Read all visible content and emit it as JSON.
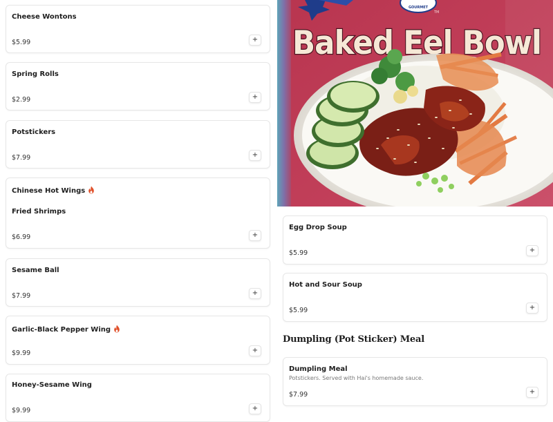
{
  "left_items": [
    {
      "name": "Cheese Wontons",
      "price": "$5.99"
    },
    {
      "name": "Spring Rolls",
      "price": "$2.99"
    },
    {
      "name": "Potstickers",
      "price": "$7.99"
    },
    {
      "name": "Chinese Hot Wings",
      "spicy": true
    },
    {
      "name": "Fried Shrimps",
      "price": "$6.99"
    },
    {
      "name": "Sesame Ball",
      "price": "$7.99"
    },
    {
      "name": "Garlic-Black Pepper Wing",
      "price": "$9.99",
      "spicy": true
    },
    {
      "name": "Honey-Sesame Wing",
      "price": "$9.99"
    }
  ],
  "hero_image": {
    "sign_text": "Baked Eel Bowl",
    "badge_text": "GOURMET",
    "tm": "TM",
    "colors": {
      "sign_bg": "#c23a52",
      "plate": "#f5f3ee"
    }
  },
  "right_items": [
    {
      "name": "Egg Drop Soup",
      "price": "$5.99"
    },
    {
      "name": "Hot and Sour Soup",
      "price": "$5.99"
    }
  ],
  "dumpling_section": {
    "heading": "Dumpling (Pot Sticker) Meal",
    "items": [
      {
        "name": "Dumpling Meal",
        "description": "Potstickers. Served with Hai's homemade sauce.",
        "price": "$7.99"
      }
    ]
  },
  "add_button_label": "+",
  "colors": {
    "spicy": "#e0502a",
    "card_border": "#e6e6e6"
  }
}
